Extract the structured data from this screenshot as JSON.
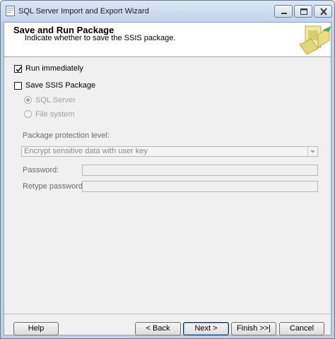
{
  "window": {
    "title": "SQL Server Import and Export Wizard"
  },
  "header": {
    "title": "Save and Run Package",
    "subtitle": "Indicate whether to save the SSIS package.",
    "graphic_icon": "wizard-graphic-icon"
  },
  "options": {
    "run_immediately": {
      "label": "Run immediately",
      "checked": true
    },
    "save_ssis_package": {
      "label": "Save SSIS Package",
      "checked": false
    },
    "sql_server": {
      "label": "SQL Server",
      "selected": true,
      "enabled": false
    },
    "file_system": {
      "label": "File system",
      "selected": false,
      "enabled": false
    }
  },
  "protection": {
    "label": "Package protection level:",
    "selected_value": "Encrypt sensitive data with user key"
  },
  "password": {
    "label": "Password:",
    "value": ""
  },
  "retype_password": {
    "label": "Retype password:",
    "value": ""
  },
  "buttons": {
    "help": "Help",
    "back": "< Back",
    "next": "Next >",
    "finish": "Finish >>|",
    "cancel": "Cancel"
  },
  "colors": {
    "header_bg": "#ffffff",
    "dialog_bg": "#f0f0f0",
    "disabled_text": "#a0a0a0",
    "titlebar": "#c0d4ec"
  }
}
